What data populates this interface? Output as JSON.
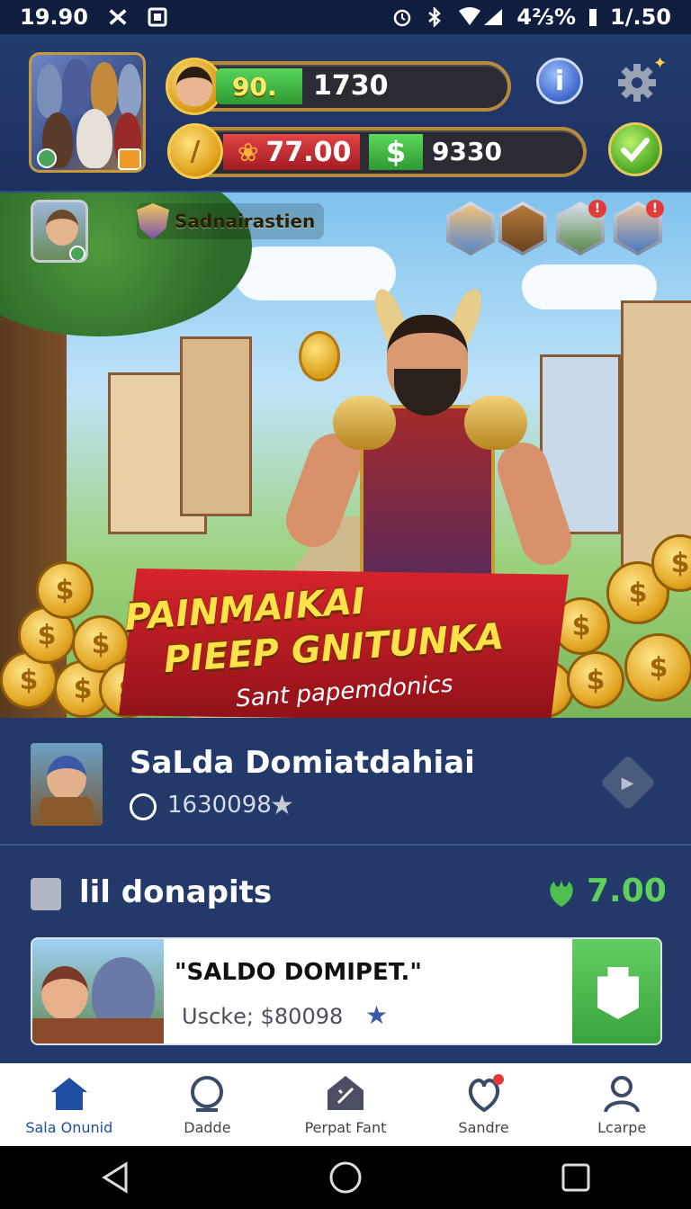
{
  "status_bar": {
    "time_left": "19.90",
    "battery": "4⅔%",
    "time_right": "1/.50"
  },
  "hud": {
    "level": "90.",
    "xp": "1730",
    "red_currency": "77.00",
    "cash_symbol": "$",
    "cash": "9330",
    "gold_coin_symbol": "/",
    "info_symbol": "i"
  },
  "banner": {
    "guild_name": "Sadnairastien",
    "title_line1": "PAINMAIKAI",
    "title_line2": "PIEEP GNITUNKA",
    "subtitle": "Sant papemdonics",
    "notification_mark": "!"
  },
  "player": {
    "name": "SaLda Domiatdahiai",
    "score": "1630098"
  },
  "deposit": {
    "label": "lil donapits",
    "amount": "7.00"
  },
  "offer": {
    "title": "\"SALDO DOMIPET.\"",
    "subtitle": "Usckе; $80098"
  },
  "nav": {
    "items": [
      {
        "label": "Sala Onunid",
        "icon": "home-icon"
      },
      {
        "label": "Dadde",
        "icon": "search-icon"
      },
      {
        "label": "Perpat Fant",
        "icon": "tag-icon"
      },
      {
        "label": "Sandre",
        "icon": "heart-icon"
      },
      {
        "label": "Lcarpe",
        "icon": "profile-icon"
      }
    ]
  },
  "colors": {
    "panel": "#23396a",
    "accent_green": "#5fd05c",
    "ribbon_red": "#d8242c",
    "gold": "#f3c94c"
  }
}
